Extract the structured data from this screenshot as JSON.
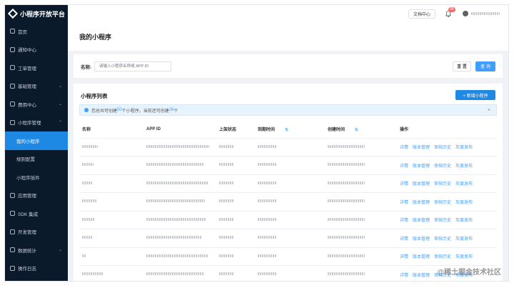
{
  "app": {
    "title": "小程序开放平台"
  },
  "sidebar": {
    "items": [
      {
        "label": "首页"
      },
      {
        "label": "通知中心"
      },
      {
        "label": "工单管理"
      },
      {
        "label": "基础管理"
      },
      {
        "label": "费用中心"
      },
      {
        "label": "小程序管理"
      },
      {
        "label": "我的小程序"
      },
      {
        "label": "规则配置"
      },
      {
        "label": "小程序插件"
      },
      {
        "label": "应用管理"
      },
      {
        "label": "SDK 集成"
      },
      {
        "label": "开发管理"
      },
      {
        "label": "数据统计"
      },
      {
        "label": "操作日志"
      }
    ]
  },
  "topbar": {
    "doc_center": "文档中心",
    "badge_count": "99"
  },
  "page": {
    "title": "我的小程序"
  },
  "search": {
    "label": "名称:",
    "placeholder": "请输入小程序名称或 APP ID",
    "reset": "重 置",
    "query": "查 询"
  },
  "list": {
    "title": "小程序列表",
    "add_button": "+ 新增小程序",
    "alert_prefix": "您总共可创建",
    "alert_total": "50",
    "alert_mid": "个小程序，当前还可创建",
    "alert_remaining": "28",
    "alert_suffix": "个",
    "alert_close": "×",
    "columns": [
      "名称",
      "APP ID",
      "上架状态",
      "到期时间",
      "创建时间",
      "操作"
    ],
    "sort_icon": "⇅",
    "actions": [
      "详情",
      "版本管理",
      "审核历史",
      "灰度发布"
    ]
  },
  "watermark": "@稀土掘金技术社区",
  "colors": {
    "sidebar_bg": "#0b1a2b",
    "primary": "#1e88e5",
    "link": "#409eff",
    "badge": "#f56c6c"
  }
}
